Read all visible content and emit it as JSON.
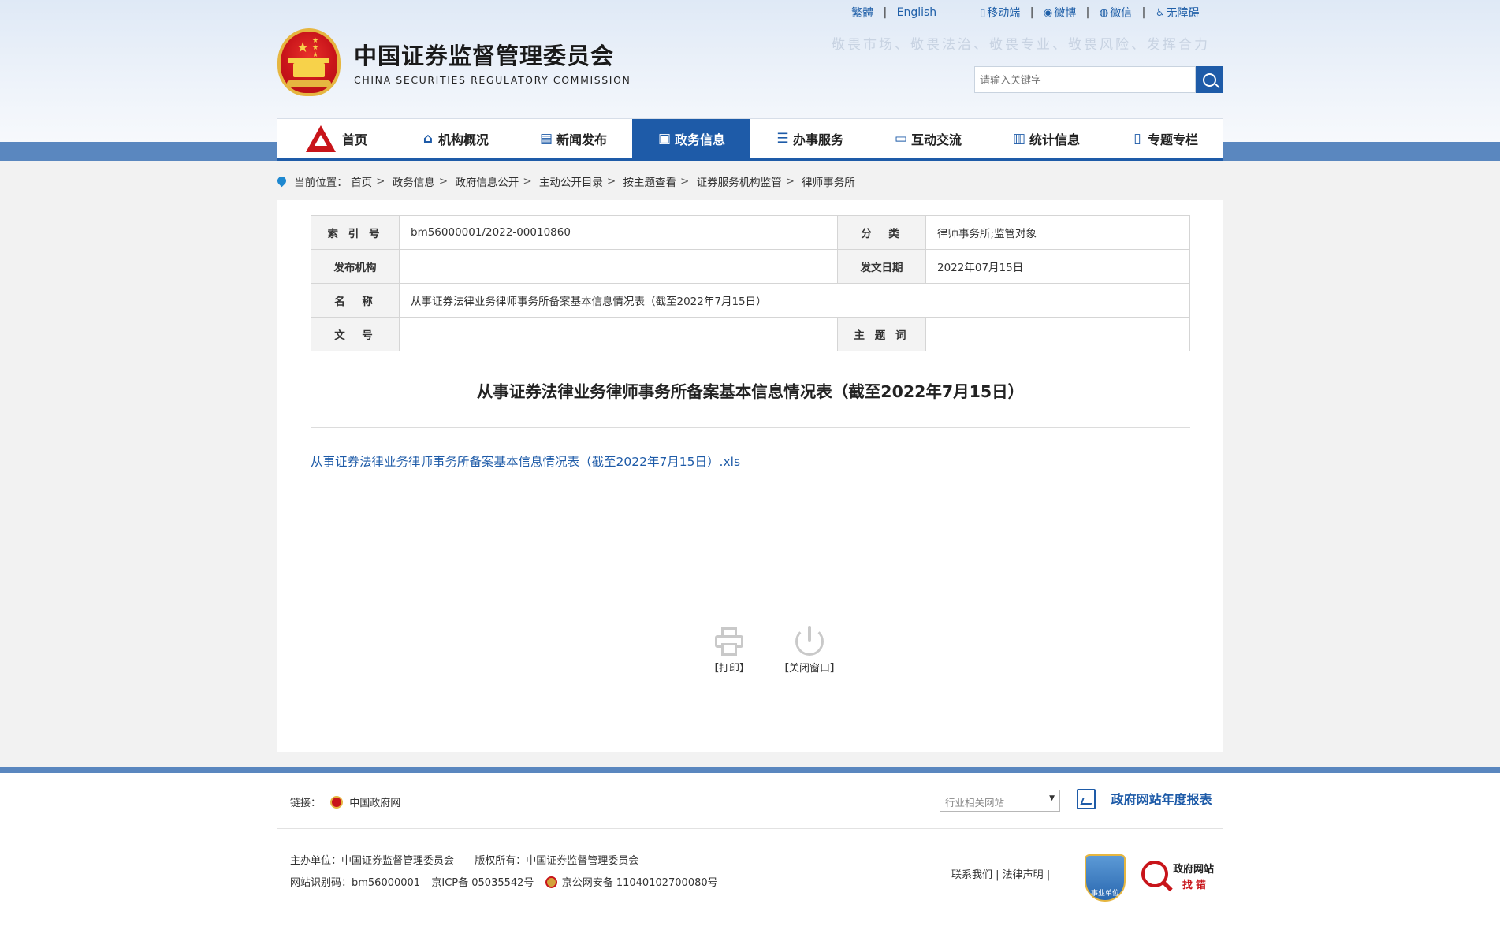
{
  "header": {
    "site_name_cn": "中国证券监督管理委员会",
    "site_name_en": "CHINA SECURITIES REGULATORY COMMISSION",
    "slogan": "敬畏市场、敬畏法治、敬畏专业、敬畏风险、发挥合力",
    "top_links": {
      "traditional": "繁體",
      "english": "English",
      "mobile": "移动端",
      "weibo": "微博",
      "wechat": "微信",
      "accessibility": "无障碍"
    },
    "search": {
      "placeholder": "请输入关键字"
    }
  },
  "nav": {
    "items": [
      {
        "label": "首页",
        "icon": "csrc-logo-icon"
      },
      {
        "label": "机构概况",
        "icon": "building-icon"
      },
      {
        "label": "新闻发布",
        "icon": "news-icon"
      },
      {
        "label": "政务信息",
        "icon": "monitor-icon",
        "active": true
      },
      {
        "label": "办事服务",
        "icon": "service-icon"
      },
      {
        "label": "互动交流",
        "icon": "chat-icon"
      },
      {
        "label": "统计信息",
        "icon": "bar-chart-icon"
      },
      {
        "label": "专题专栏",
        "icon": "document-icon"
      }
    ]
  },
  "breadcrumb": {
    "prefix": "当前位置：",
    "items": [
      "首页",
      "政务信息",
      "政府信息公开",
      "主动公开目录",
      "按主题查看",
      "证券服务机构监管",
      "律师事务所"
    ]
  },
  "meta": {
    "index_label": "索 引 号",
    "index_value": "bm56000001/2022-00010860",
    "category_label": "分　类",
    "category_value": "律师事务所;监管对象",
    "publisher_label": "发布机构",
    "publisher_value": "",
    "date_label": "发文日期",
    "date_value": "2022年07月15日",
    "name_label": "名　称",
    "name_value": "从事证券法律业务律师事务所备案基本信息情况表（截至2022年7月15日）",
    "docno_label": "文　号",
    "docno_value": "",
    "keywords_label": "主 题 词",
    "keywords_value": ""
  },
  "document": {
    "title": "从事证券法律业务律师事务所备案基本信息情况表（截至2022年7月15日）",
    "attachment": "从事证券法律业务律师事务所备案基本信息情况表（截至2022年7月15日）.xls"
  },
  "tools": {
    "print": "【打印】",
    "close": "【关闭窗口】"
  },
  "footer": {
    "links_label": "链接：",
    "gov_link": "中国政府网",
    "related_sites": "行业相关网站",
    "annual_report": "政府网站年度报表",
    "host": "主办单位：中国证券监督管理委员会",
    "copyright": "版权所有：中国证券监督管理委员会",
    "site_id": "网站识别码：bm56000001",
    "icp": "京ICP备 05035542号",
    "police": "京公网安备 11040102700080号",
    "contact": "联系我们",
    "legal": "法律声明",
    "badge_institution": "事业单位",
    "badge_error_line1": "政府网站",
    "badge_error_line2": "找错"
  }
}
